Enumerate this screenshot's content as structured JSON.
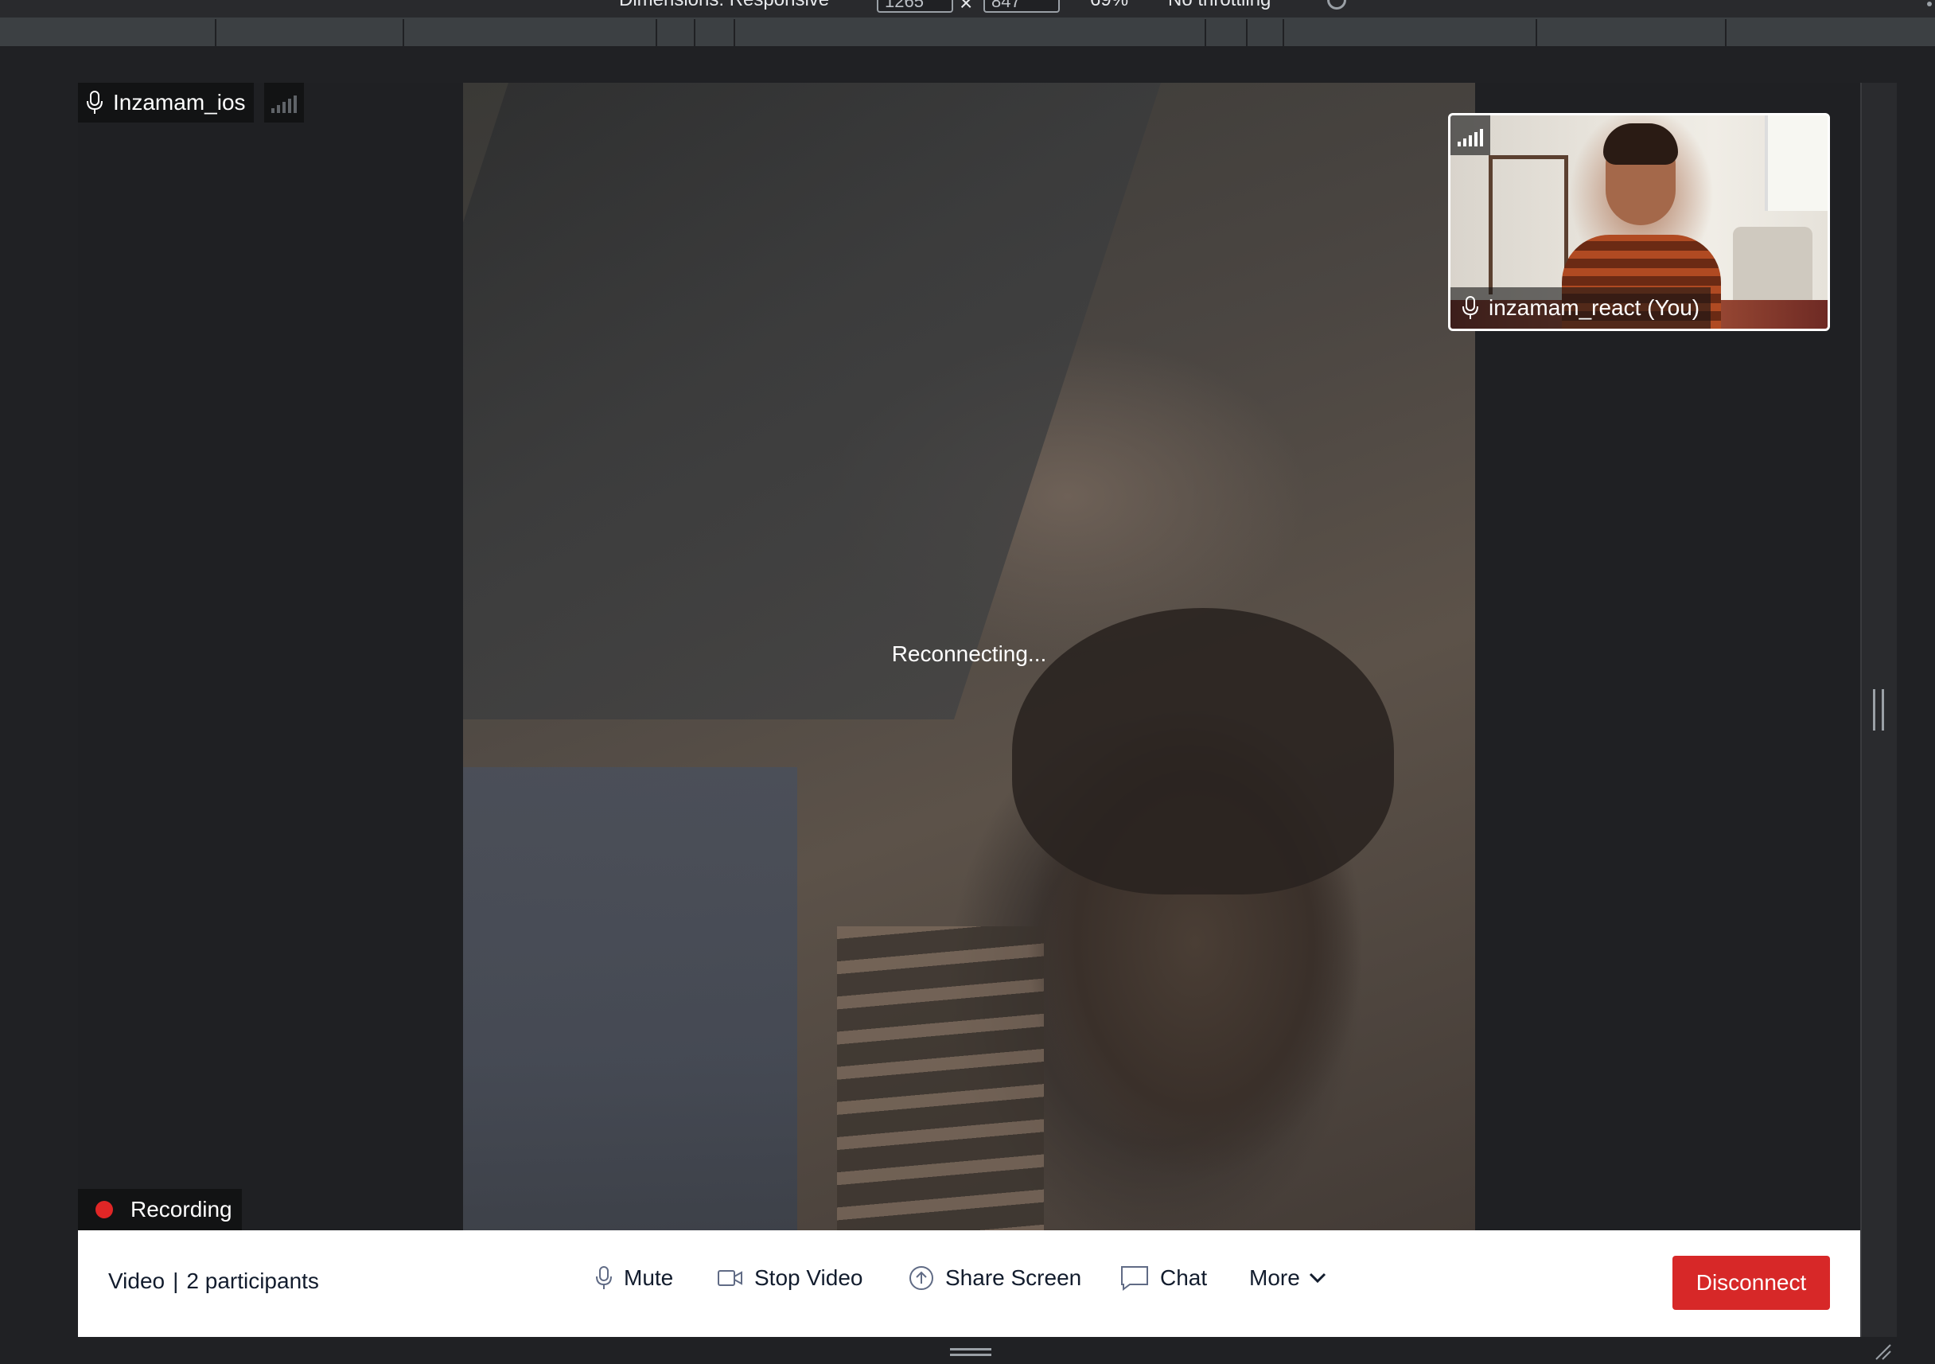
{
  "devtools": {
    "dimensions_label": "Dimensions: Responsive",
    "width_value": "1265",
    "height_value": "847",
    "times_symbol": "×",
    "zoom": "69%",
    "throttling": "No throttling"
  },
  "main_participant": {
    "name": "Inzamam_ios",
    "status": "Reconnecting..."
  },
  "local_participant": {
    "name": "inzamam_react (You)"
  },
  "recording": {
    "label": "Recording",
    "color": "#e02626"
  },
  "menu_bar": {
    "room_type": "Video",
    "separator": "|",
    "participants": "2 participants",
    "mute_label": "Mute",
    "stop_video_label": "Stop Video",
    "share_screen_label": "Share Screen",
    "chat_label": "Chat",
    "more_label": "More",
    "disconnect_label": "Disconnect"
  },
  "colors": {
    "disconnect": "#d72828",
    "menu_bg": "#ffffff",
    "stage_bg": "#1f2023"
  }
}
